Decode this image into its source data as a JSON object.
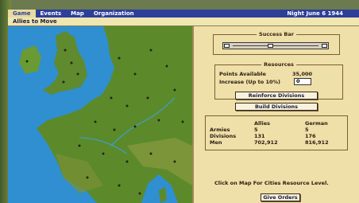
{
  "menubar": {
    "items": [
      "Game",
      "Events",
      "Map",
      "Organization"
    ],
    "active_index": 0,
    "date": "Night June 6 1944"
  },
  "window": {
    "title": "Allies to Move"
  },
  "success_bar": {
    "title": "Success Bar",
    "level": 0.45
  },
  "resources": {
    "title": "Resources",
    "points_label": "Points Available",
    "points_value": "35,000",
    "increase_label": "Increase (Up to 10%)",
    "increase_value": "0",
    "reinforce_button": "Reinforce Divisions",
    "build_button": "Build Divisions"
  },
  "stats": {
    "headers": [
      "",
      "Allies",
      "German"
    ],
    "rows": [
      [
        "Armies",
        "5",
        "5"
      ],
      [
        "Divisions",
        "131",
        "176"
      ],
      [
        "Men",
        "702,912",
        "816,912"
      ]
    ]
  },
  "hint": "Click on Map For Cities Resource Level.",
  "give_orders_button": "Give Orders",
  "colors": {
    "menubar": "#2e3f9a",
    "panel": "#efdfa8",
    "sea": "#2f8fd0",
    "land": "#5c8a2a"
  }
}
